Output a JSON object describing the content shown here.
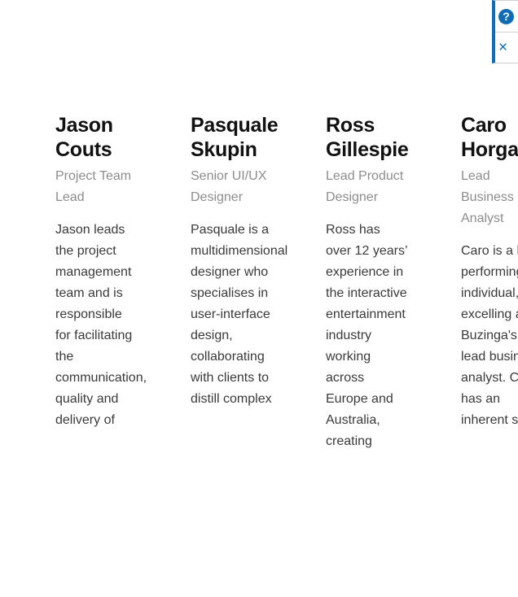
{
  "widget": {
    "help_icon": "question-mark-icon",
    "help_label": "?",
    "close_icon": "close-icon",
    "close_label": "×",
    "accent_color": "#0f6cb5"
  },
  "team": {
    "members": [
      {
        "name": "Jason Couts",
        "role": "Project Team Lead",
        "bio": "Jason leads the project management team and is responsible for facilitating the communication, quality and delivery of"
      },
      {
        "name": "Pasquale Skupin",
        "role": "Senior UI/UX Designer",
        "bio": "Pasquale is a multidimensional designer who specialises in user-interface design, collaborating with clients to distill complex"
      },
      {
        "name": "Ross Gillespie",
        "role": "Lead Product Designer",
        "bio": "Ross has over 12 years’ experience in the interactive entertainment industry working across Europe and Australia, creating"
      },
      {
        "name": "Caro Horgan",
        "role": "Lead Business Analyst",
        "bio": "Caro is a high performing individual, excelling as Buzinga's lead business analyst. Caro has an inherent skill"
      }
    ]
  }
}
